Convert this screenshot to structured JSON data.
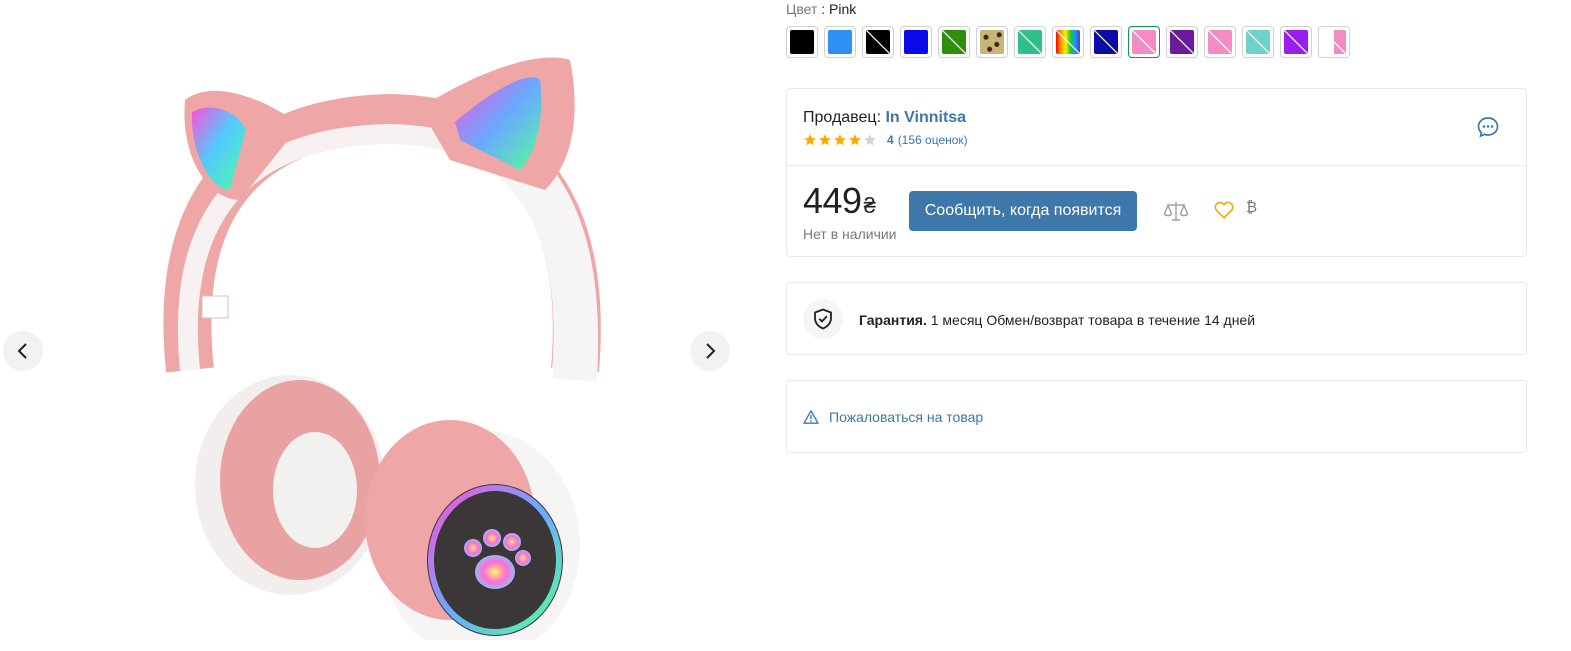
{
  "color": {
    "label": "Цвет",
    "sep": " : ",
    "value": "Pink"
  },
  "swatches": [
    {
      "name": "black",
      "fill": "#000000",
      "pattern": "solid"
    },
    {
      "name": "blue-light",
      "fill": "#2f8ff5",
      "pattern": "solid"
    },
    {
      "name": "black-diag",
      "fill": "#000000",
      "pattern": "diag"
    },
    {
      "name": "blue",
      "fill": "#0a0ae8",
      "pattern": "solid"
    },
    {
      "name": "green-diag",
      "fill": "#2f8f0a",
      "pattern": "diag"
    },
    {
      "name": "leopard",
      "fill": "#c9b47a",
      "pattern": "leopard"
    },
    {
      "name": "teal-diag",
      "fill": "#2ebf8a",
      "pattern": "diag"
    },
    {
      "name": "rainbow",
      "fill": "#ff0000",
      "pattern": "rainbow"
    },
    {
      "name": "navy-diag",
      "fill": "#0b0ba8",
      "pattern": "diag"
    },
    {
      "name": "pink-diag",
      "fill": "#f48cc4",
      "pattern": "diag",
      "selected": true
    },
    {
      "name": "purple-diag",
      "fill": "#6a1a9a",
      "pattern": "diag"
    },
    {
      "name": "pink-2",
      "fill": "#f48cc4",
      "pattern": "diag"
    },
    {
      "name": "mint-diag",
      "fill": "#6fd2c8",
      "pattern": "diag"
    },
    {
      "name": "violet-diag",
      "fill": "#9a1df0",
      "pattern": "diag"
    },
    {
      "name": "white-pink",
      "fill": "#f48cc4",
      "pattern": "half"
    }
  ],
  "seller": {
    "label": "Продавец:",
    "name": "In Vinnitsa",
    "rating_value": "4",
    "rating_count": "(156 оценок)",
    "stars_filled": 4,
    "stars_total": 5
  },
  "price": {
    "value": "449",
    "currency": "₴",
    "stock_status": "Нет в наличии",
    "notify_label": "Сообщить, когда появится",
    "bonus_symbol": "₿"
  },
  "warranty": {
    "title": "Гарантия.",
    "text": "1 месяц Обмен/возврат товара в течение 14 дней"
  },
  "report": {
    "label": "Пожаловаться на товар"
  },
  "colors": {
    "accent": "#3e77aa",
    "star": "#ffa900",
    "selected_border": "#00a046",
    "wish": "#ffa900"
  }
}
